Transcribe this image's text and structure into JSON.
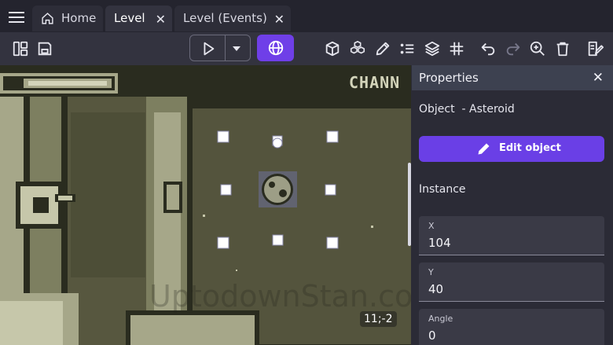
{
  "tabs": [
    {
      "label": "Home",
      "icon": "home-icon",
      "active": false
    },
    {
      "label": "Level",
      "active": true
    },
    {
      "label": "Level (Events)",
      "active": false
    }
  ],
  "toolbar": {
    "accent_color": "#6f3fe8",
    "icons": [
      "panels-icon",
      "save-icon",
      "play-icon",
      "dropdown-icon",
      "globe-icon",
      "cube-icon",
      "objects-group-icon",
      "pencil-icon",
      "list-icon",
      "layers-icon",
      "grid-icon",
      "undo-icon",
      "redo-icon",
      "zoom-in-icon",
      "trash-icon",
      "edit-notes-icon"
    ]
  },
  "scene": {
    "hud_text": "CHANN",
    "coords": "11;-2",
    "watermark": "UptodownStan.com"
  },
  "properties": {
    "title": "Properties",
    "object_label": "Object  - Asteroid",
    "edit_button": "Edit object",
    "section": "Instance",
    "fields": [
      {
        "label": "X",
        "value": "104"
      },
      {
        "label": "Y",
        "value": "40"
      },
      {
        "label": "Angle",
        "value": "0"
      }
    ]
  }
}
